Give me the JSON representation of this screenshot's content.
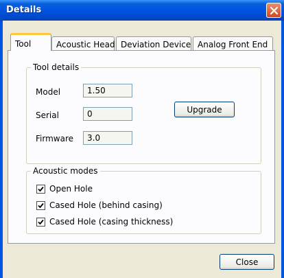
{
  "window": {
    "title": "Details"
  },
  "tabs": [
    {
      "label": "Tool",
      "active": true
    },
    {
      "label": "Acoustic Head",
      "active": false
    },
    {
      "label": "Deviation Device",
      "active": false
    },
    {
      "label": "Analog Front End",
      "active": false
    }
  ],
  "tool_details": {
    "legend": "Tool details",
    "model_label": "Model",
    "model_value": "1.50",
    "serial_label": "Serial",
    "serial_value": "0",
    "firmware_label": "Firmware",
    "firmware_value": "3.0",
    "upgrade_label": "Upgrade"
  },
  "acoustic_modes": {
    "legend": "Acoustic modes",
    "options": [
      {
        "label": "Open Hole",
        "checked": true
      },
      {
        "label": "Cased Hole (behind casing)",
        "checked": true
      },
      {
        "label": "Cased Hole (casing thickness)",
        "checked": true
      }
    ]
  },
  "footer": {
    "close_label": "Close"
  },
  "colors": {
    "titlebar": "#0054e3",
    "dialog_bg": "#ECE9D8",
    "active_tab_accent": "#ffc83c"
  }
}
